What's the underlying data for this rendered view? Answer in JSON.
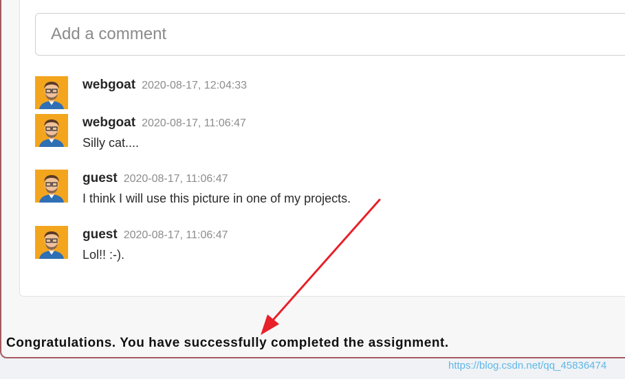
{
  "comment_box": {
    "placeholder": "Add a comment"
  },
  "comments": [
    {
      "author": "webgoat",
      "time": "2020-08-17, 12:04:33",
      "text": ""
    },
    {
      "author": "webgoat",
      "time": "2020-08-17, 11:06:47",
      "text": "Silly cat...."
    },
    {
      "author": "guest",
      "time": "2020-08-17, 11:06:47",
      "text": "I think I will use this picture in one of my projects."
    },
    {
      "author": "guest",
      "time": "2020-08-17, 11:06:47",
      "text": "Lol!! :-)."
    }
  ],
  "feedback": {
    "message": "Congratulations. You have successfully completed the assignment."
  },
  "watermark": "https://blog.csdn.net/qq_45836474",
  "colors": {
    "annotation_arrow": "#e8202a",
    "avatar_bg": "#f3a51e",
    "frame_border": "#a55a5e"
  }
}
